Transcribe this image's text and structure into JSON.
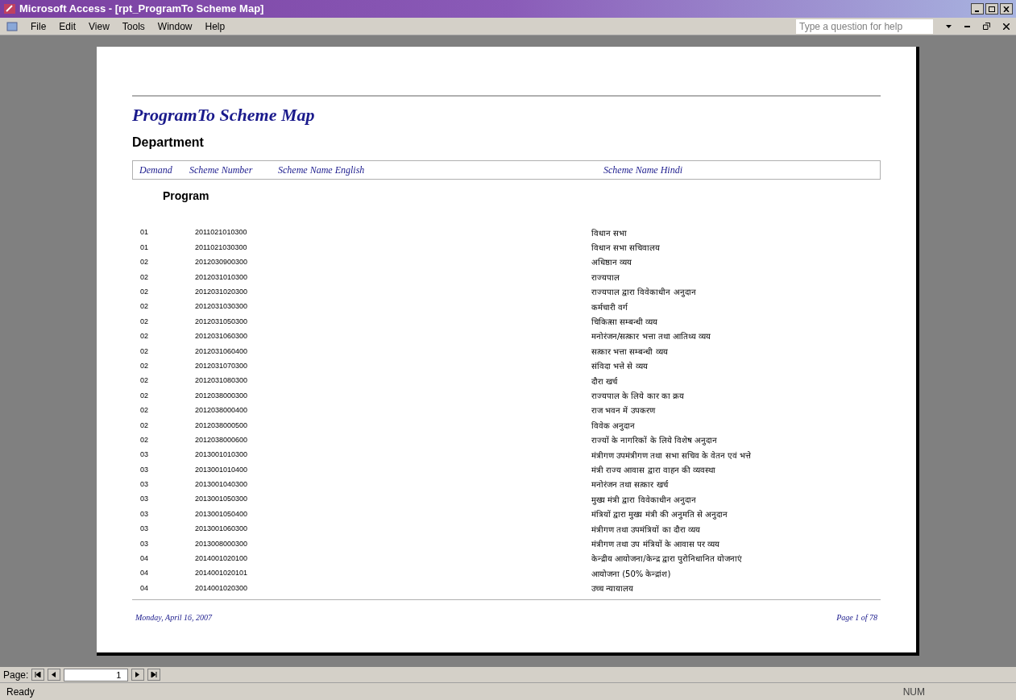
{
  "window": {
    "title": "Microsoft Access - [rpt_ProgramTo Scheme Map]"
  },
  "menu": [
    "File",
    "Edit",
    "View",
    "Tools",
    "Window",
    "Help"
  ],
  "help_box": {
    "placeholder": "Type a question for help"
  },
  "report": {
    "title": "ProgramTo Scheme Map",
    "group_heading": "Department",
    "columns": [
      "Demand",
      "Scheme Number",
      "Scheme Name English",
      "Scheme Name Hindi"
    ],
    "subgroup_heading": "Program",
    "rows": [
      {
        "demand": "01",
        "number": "2011021010300",
        "hindi": "विधान सभा"
      },
      {
        "demand": "01",
        "number": "2011021030300",
        "hindi": "विधान सभा सचिवालय"
      },
      {
        "demand": "02",
        "number": "2012030900300",
        "hindi": "अधिष्ठान व्यय"
      },
      {
        "demand": "02",
        "number": "2012031010300",
        "hindi": "राज्यपाल"
      },
      {
        "demand": "02",
        "number": "2012031020300",
        "hindi": "राज्यपाल द्वारा विवेकाधीन अनुदान"
      },
      {
        "demand": "02",
        "number": "2012031030300",
        "hindi": "कर्मचारी वर्ग"
      },
      {
        "demand": "02",
        "number": "2012031050300",
        "hindi": "चिकित्सा सम्बन्धी व्यय"
      },
      {
        "demand": "02",
        "number": "2012031060300",
        "hindi": "मनोरंजन/सत्कार भत्ता तथा आतिथ्य व्यय"
      },
      {
        "demand": "02",
        "number": "2012031060400",
        "hindi": "सत्कार भत्ता सम्बन्धी व्यय"
      },
      {
        "demand": "02",
        "number": "2012031070300",
        "hindi": "संविदा भत्ते से व्यय"
      },
      {
        "demand": "02",
        "number": "2012031080300",
        "hindi": "दौरा खर्च"
      },
      {
        "demand": "02",
        "number": "2012038000300",
        "hindi": "राज्यपाल के लिये कार का क्रय"
      },
      {
        "demand": "02",
        "number": "2012038000400",
        "hindi": "राज भवन में उपकरण"
      },
      {
        "demand": "02",
        "number": "2012038000500",
        "hindi": "विवेक अनुदान"
      },
      {
        "demand": "02",
        "number": "2012038000600",
        "hindi": "राज्यों के नागरिकों के लिये विशेष अनुदान"
      },
      {
        "demand": "03",
        "number": "2013001010300",
        "hindi": "मंत्रीगण उपमंत्रीगण तथा सभा सचिव के वेतन एवं भत्ते"
      },
      {
        "demand": "03",
        "number": "2013001010400",
        "hindi": "मंत्री राज्य आवास द्वारा वाहन की व्यवस्था"
      },
      {
        "demand": "03",
        "number": "2013001040300",
        "hindi": "मनोरंजन तथा सत्कार खर्च"
      },
      {
        "demand": "03",
        "number": "2013001050300",
        "hindi": "मुख्य मंत्री द्वारा विवेकाधीन अनुदान"
      },
      {
        "demand": "03",
        "number": "2013001050400",
        "hindi": "मंत्रियों द्वारा मुख्य मंत्री की अनुमति से अनुदान"
      },
      {
        "demand": "03",
        "number": "2013001060300",
        "hindi": "मंत्रीगण तथा उपमंत्रियों का दौरा व्यय"
      },
      {
        "demand": "03",
        "number": "2013008000300",
        "hindi": "मंत्रीगण तथा उप मंत्रियों के आवास पर व्यय"
      },
      {
        "demand": "04",
        "number": "2014001020100",
        "hindi": "केन्द्रीय आयोजना/केन्द्र द्वारा पुरोनिधानित योजनाएं"
      },
      {
        "demand": "04",
        "number": "2014001020101",
        "hindi": "आयोजना (50% केन्द्रांश)"
      },
      {
        "demand": "04",
        "number": "2014001020300",
        "hindi": "उच्च न्यायालय"
      }
    ],
    "footer_date": "Monday, April 16, 2007",
    "footer_page": "Page 1 of 78"
  },
  "navigation": {
    "label": "Page:",
    "page": "1"
  },
  "status_bar": {
    "text": "Ready",
    "indicator": "NUM"
  }
}
